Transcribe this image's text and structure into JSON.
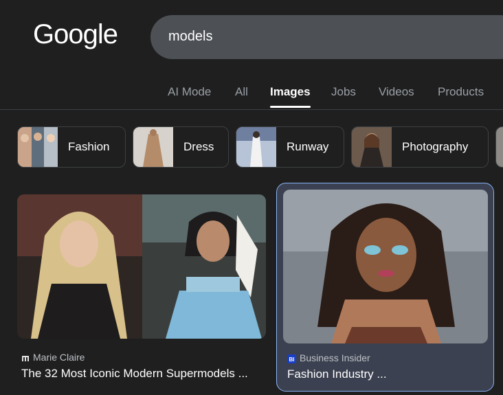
{
  "logo": "Google",
  "search": {
    "query": "models"
  },
  "tabs": [
    {
      "label": "AI Mode",
      "active": false
    },
    {
      "label": "All",
      "active": false
    },
    {
      "label": "Images",
      "active": true
    },
    {
      "label": "Jobs",
      "active": false
    },
    {
      "label": "Videos",
      "active": false
    },
    {
      "label": "Products",
      "active": false
    }
  ],
  "chips": [
    {
      "label": "Fashion"
    },
    {
      "label": "Dress"
    },
    {
      "label": "Runway"
    },
    {
      "label": "Photography"
    }
  ],
  "results": [
    {
      "source": "Marie Claire",
      "title": "The 32 Most Iconic Modern Supermodels ..."
    },
    {
      "source": "Business Insider",
      "title": "Fashion Industry ..."
    }
  ],
  "colors": {
    "background": "#1f1f1f",
    "search_box": "#4d5156",
    "selected_card": "#3b4150",
    "selected_border": "#8ab4f8"
  }
}
